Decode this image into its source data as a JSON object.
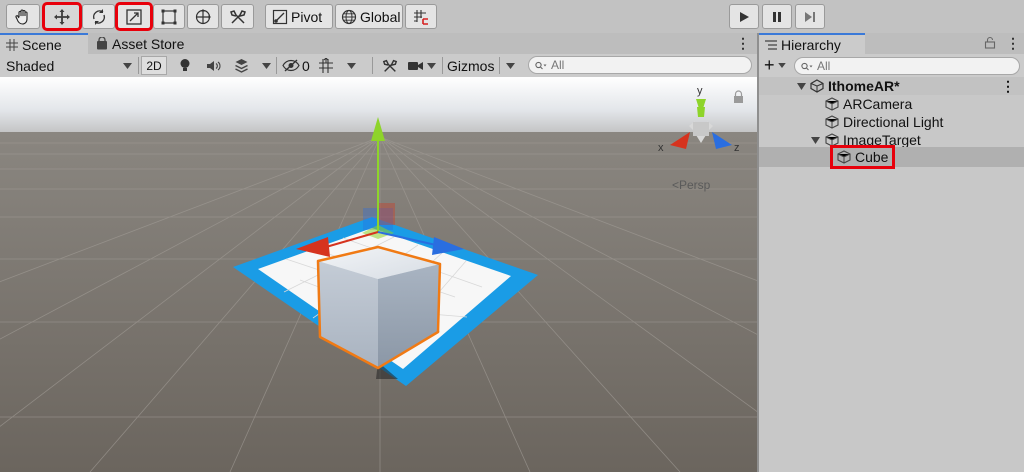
{
  "toolbar": {
    "pivot_label": "Pivot",
    "global_label": "Global"
  },
  "scene_panel": {
    "tabs": [
      {
        "label": "Scene",
        "icon": "grid-icon",
        "active": true
      },
      {
        "label": "Asset Store",
        "icon": "shopping-bag-icon",
        "active": false
      }
    ],
    "shading_mode": "Shaded",
    "toggle_2d": "2D",
    "hidden_count": "0",
    "gizmos_label": "Gizmos",
    "search_placeholder": "All",
    "orientation": {
      "x_label": "x",
      "y_label": "y",
      "z_label": "z",
      "projection": "<Persp"
    }
  },
  "hierarchy": {
    "tab_label": "Hierarchy",
    "add_label": "+",
    "search_placeholder": "All",
    "scene_name": "IthomeAR*",
    "items": [
      {
        "label": "ARCamera",
        "depth": 1
      },
      {
        "label": "Directional Light",
        "depth": 1
      },
      {
        "label": "ImageTarget",
        "depth": 1,
        "expanded": true
      },
      {
        "label": "Cube",
        "depth": 2,
        "selected": true
      }
    ]
  },
  "colors": {
    "highlight": "#e8000b",
    "target_blue": "#1a9ce6",
    "selection_outline": "#f07a14",
    "x_axis": "#d6331e",
    "y_axis": "#8ed42a",
    "z_axis": "#2a6ee0"
  }
}
